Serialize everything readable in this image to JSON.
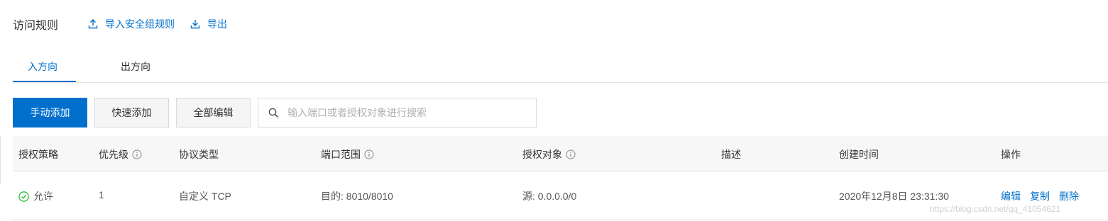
{
  "header": {
    "title": "访问规则",
    "import_label": "导入安全组规则",
    "export_label": "导出"
  },
  "tabs": [
    {
      "label": "入方向",
      "active": true
    },
    {
      "label": "出方向",
      "active": false
    }
  ],
  "toolbar": {
    "manual_add": "手动添加",
    "quick_add": "快速添加",
    "edit_all": "全部编辑",
    "search_placeholder": "输入端口或者授权对象进行搜索"
  },
  "table": {
    "columns": [
      "授权策略",
      "优先级",
      "协议类型",
      "端口范围",
      "授权对象",
      "描述",
      "创建时间",
      "操作"
    ],
    "rows": [
      {
        "policy": "允许",
        "priority": "1",
        "protocol": "自定义 TCP",
        "port_range": "目的: 8010/8010",
        "auth_object": "源: 0.0.0.0/0",
        "description": "",
        "created": "2020年12月8日 23:31:30",
        "actions": [
          "编辑",
          "复制",
          "删除"
        ]
      }
    ]
  },
  "watermark": "https://blog.csdn.net/qq_41054621",
  "colors": {
    "accent": "#0070cc",
    "success": "#1fb82a"
  },
  "icons": [
    "upload-icon",
    "download-icon",
    "search-icon",
    "info-icon",
    "check-circle-icon"
  ]
}
